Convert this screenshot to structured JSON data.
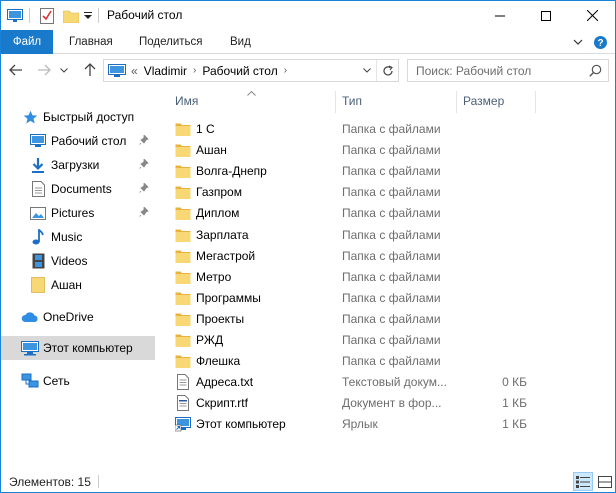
{
  "window": {
    "title": "Рабочий стол"
  },
  "ribbon": {
    "tabs": [
      "Файл",
      "Главная",
      "Поделиться",
      "Вид"
    ]
  },
  "address": {
    "overflow": "«",
    "segments": [
      "Vladimir",
      "Рабочий стол"
    ]
  },
  "search": {
    "placeholder": "Поиск: Рабочий стол"
  },
  "sidebar": {
    "quick_access": "Быстрый доступ",
    "items": [
      {
        "label": "Рабочий стол",
        "icon": "desktop-icon",
        "pinned": true
      },
      {
        "label": "Загрузки",
        "icon": "downloads-icon",
        "pinned": true
      },
      {
        "label": "Documents",
        "icon": "documents-icon",
        "pinned": true
      },
      {
        "label": "Pictures",
        "icon": "pictures-icon",
        "pinned": true
      },
      {
        "label": "Music",
        "icon": "music-icon",
        "pinned": false
      },
      {
        "label": "Videos",
        "icon": "videos-icon",
        "pinned": false
      },
      {
        "label": "Ашан",
        "icon": "folder-icon",
        "pinned": false
      }
    ],
    "onedrive": "OneDrive",
    "this_pc": "Этот компьютер",
    "network": "Сеть"
  },
  "columns": {
    "name": "Имя",
    "type": "Тип",
    "size": "Размер"
  },
  "files": [
    {
      "name": "1 С",
      "type": "Папка с файлами",
      "size": "",
      "icon": "folder"
    },
    {
      "name": "Ашан",
      "type": "Папка с файлами",
      "size": "",
      "icon": "folder"
    },
    {
      "name": "Волга-Днепр",
      "type": "Папка с файлами",
      "size": "",
      "icon": "folder"
    },
    {
      "name": "Газпром",
      "type": "Папка с файлами",
      "size": "",
      "icon": "folder"
    },
    {
      "name": "Диплом",
      "type": "Папка с файлами",
      "size": "",
      "icon": "folder"
    },
    {
      "name": "Зарплата",
      "type": "Папка с файлами",
      "size": "",
      "icon": "folder"
    },
    {
      "name": "Мегастрой",
      "type": "Папка с файлами",
      "size": "",
      "icon": "folder"
    },
    {
      "name": "Метро",
      "type": "Папка с файлами",
      "size": "",
      "icon": "folder"
    },
    {
      "name": "Программы",
      "type": "Папка с файлами",
      "size": "",
      "icon": "folder"
    },
    {
      "name": "Проекты",
      "type": "Папка с файлами",
      "size": "",
      "icon": "folder"
    },
    {
      "name": "РЖД",
      "type": "Папка с файлами",
      "size": "",
      "icon": "folder"
    },
    {
      "name": "Флешка",
      "type": "Папка с файлами",
      "size": "",
      "icon": "folder"
    },
    {
      "name": "Адреса.txt",
      "type": "Текстовый докум...",
      "size": "0 КБ",
      "icon": "text-file"
    },
    {
      "name": "Скрипт.rtf",
      "type": "Документ в фор...",
      "size": "1 КБ",
      "icon": "rtf-file"
    },
    {
      "name": "Этот компьютер",
      "type": "Ярлык",
      "size": "1 КБ",
      "icon": "shortcut"
    }
  ],
  "status": {
    "count_text": "Элементов: 15"
  },
  "colors": {
    "accent": "#1979ca",
    "folder": "#f8d775"
  }
}
